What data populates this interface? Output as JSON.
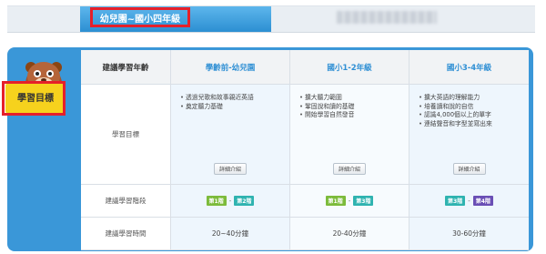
{
  "header": {
    "grade_title": "幼兒園~國小四年級"
  },
  "badge": {
    "label": "學習目標"
  },
  "table": {
    "corner_label": "建議學習年齡",
    "columns": [
      {
        "label": "學齡前-幼兒園"
      },
      {
        "label": "國小1-2年級"
      },
      {
        "label": "國小3-4年級"
      }
    ],
    "rows": {
      "goals_label": "學習目標",
      "stages_label": "建議學習階段",
      "time_label": "建議學習時間"
    },
    "goals": [
      [
        "透過兒歌和故事親近英語",
        "奠定聽力基礎"
      ],
      [
        "擴大聽力範圍",
        "鞏固說和讀的基礎",
        "開始學習自然發音"
      ],
      [
        "擴大英語的理解能力",
        "培養讀和說的自信",
        "認識4,000個以上的單字",
        "連結聲音和字型並寫出來"
      ]
    ],
    "detail_button_label": "詳細介紹",
    "stages": [
      {
        "a": "第1階",
        "sep": "-",
        "b": "第2階"
      },
      {
        "a": "第1階",
        "sep": "-",
        "b": "第3階"
      },
      {
        "a": "第3階",
        "sep": "-",
        "b": "第4階"
      }
    ],
    "times": [
      "20~40分鐘",
      "20-40分鐘",
      "30-60分鐘"
    ]
  },
  "colors": {
    "accent_blue": "#3a97d8",
    "highlight_red": "#e5202a",
    "badge_yellow": "#f6d21d",
    "stage_green": "#7cbb3b",
    "stage_teal": "#2fb3b0",
    "stage_purple": "#6a4fb5"
  },
  "icons": {
    "mascot": "beaver-mascot-icon"
  }
}
